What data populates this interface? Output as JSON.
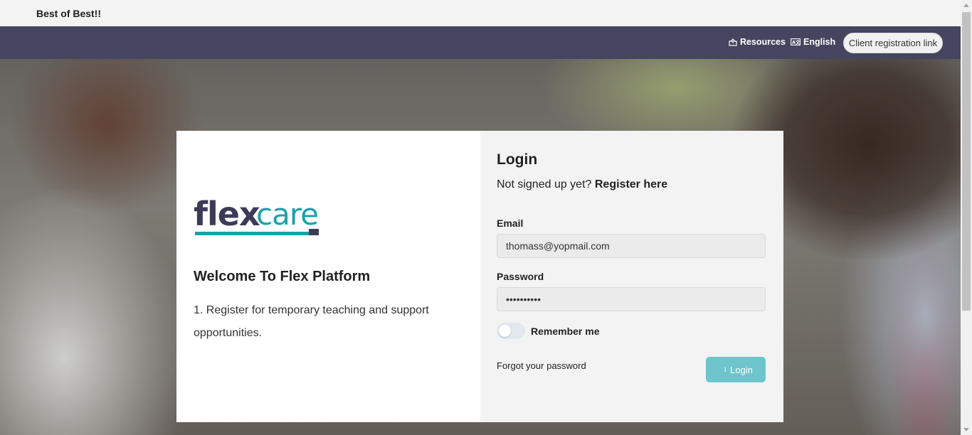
{
  "topbar": {
    "brand": "Best of Best!!"
  },
  "nav": {
    "resources": {
      "label": "Resources",
      "icon": "box-icon"
    },
    "language": {
      "label": "English",
      "icon": "language-icon"
    },
    "client_registration": "Client registration link"
  },
  "intro": {
    "logo": {
      "part1": "flex",
      "part2": "care",
      "color_primary": "#3c3b57",
      "color_accent": "#1aa2a8"
    },
    "welcome": "Welcome To Flex Platform",
    "description": "1. Register for temporary teaching and support opportunities."
  },
  "login": {
    "title": "Login",
    "signup_prompt": "Not signed up yet?",
    "register_link": "Register here",
    "email_label": "Email",
    "email_value": "thomass@yopmail.com",
    "password_label": "Password",
    "password_value": "••••••••••",
    "remember_label": "Remember me",
    "remember_checked": false,
    "forgot_link": "Forgot your password",
    "submit_label": "Login",
    "submit_color": "#6ec5cc"
  },
  "colors": {
    "navbar": "#45455f"
  }
}
